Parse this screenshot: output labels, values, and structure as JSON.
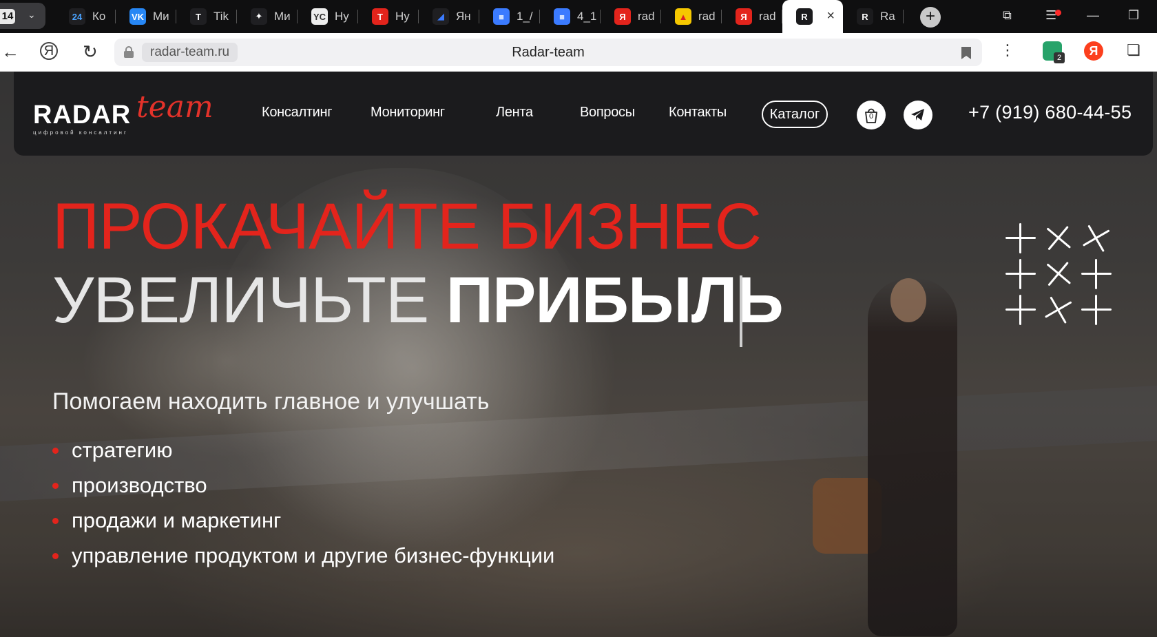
{
  "browser": {
    "tab_counter": "14",
    "tabs": [
      {
        "icon": "24",
        "label": "Ко",
        "icon_bg": "#1f1f22",
        "icon_color": "#4aa3ff"
      },
      {
        "icon": "VK",
        "label": "Ми",
        "icon_bg": "#2787f5",
        "icon_color": "#ffffff"
      },
      {
        "icon": "T",
        "label": "Tik",
        "icon_bg": "#1f1f22",
        "icon_color": "#ffffff"
      },
      {
        "icon": "✦",
        "label": "Ми",
        "icon_bg": "#1f1f22",
        "icon_color": "#ffffff"
      },
      {
        "icon": "YC",
        "label": "Ну",
        "icon_bg": "#eeeeee",
        "icon_color": "#333333"
      },
      {
        "icon": "T",
        "label": "Ну",
        "icon_bg": "#e3241c",
        "icon_color": "#ffffff"
      },
      {
        "icon": "◢",
        "label": "Ян",
        "icon_bg": "#1f1f22",
        "icon_color": "#3b7bff"
      },
      {
        "icon": "■",
        "label": "1_/",
        "icon_bg": "#3b7bff",
        "icon_color": "#cfe0ff"
      },
      {
        "icon": "■",
        "label": "4_1",
        "icon_bg": "#3b7bff",
        "icon_color": "#cfe0ff"
      },
      {
        "icon": "Я",
        "label": "rad",
        "icon_bg": "#e3241c",
        "icon_color": "#ffffff"
      },
      {
        "icon": "▲",
        "label": "rad",
        "icon_bg": "#f6c800",
        "icon_color": "#d22"
      },
      {
        "icon": "Я",
        "label": "rad",
        "icon_bg": "#e3241c",
        "icon_color": "#ffffff"
      },
      {
        "icon": "R",
        "label": "",
        "icon_bg": "#1b1b1d",
        "icon_color": "#ffffff",
        "active": true
      },
      {
        "icon": "R",
        "label": "Ra",
        "icon_bg": "#1b1b1d",
        "icon_color": "#ffffff"
      }
    ],
    "url_domain": "radar-team.ru",
    "page_title": "Radar-team",
    "extension_badge": "2"
  },
  "header": {
    "logo_main": "RADAR",
    "logo_script": "team",
    "logo_sub": "цифровой консалтинг",
    "nav": [
      "Консалтинг",
      "Мониторинг",
      "Лента",
      "Вопросы",
      "Контакты"
    ],
    "catalog_label": "Каталог",
    "cart_count": "0",
    "phone": "+7 (919) 680-44-55"
  },
  "hero": {
    "line1": "ПРОКАЧАЙТЕ БИЗНЕС",
    "line2_light": "УВЕЛИЧЬТЕ ",
    "line2_bold": "ПРИБЫЛЬ",
    "lead": "Помогаем находить главное и улучшать",
    "bullets": [
      "стратегию",
      "производство",
      "продажи и маркетинг",
      "управление продуктом и другие бизнес-функции"
    ]
  },
  "colors": {
    "accent": "#e3241c",
    "header_bg": "#1b1b1d"
  }
}
